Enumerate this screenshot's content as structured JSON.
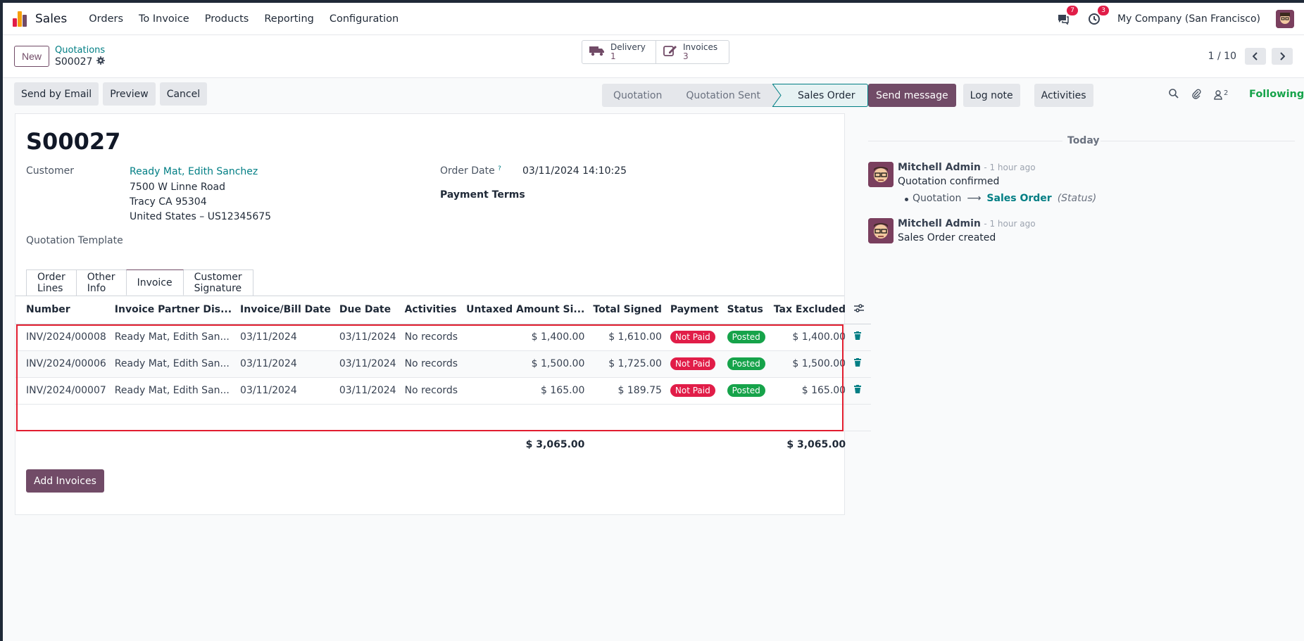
{
  "navbar": {
    "app_name": "Sales",
    "menu": [
      "Orders",
      "To Invoice",
      "Products",
      "Reporting",
      "Configuration"
    ],
    "messages_badge": "7",
    "activities_badge": "3",
    "company": "My Company (San Francisco)"
  },
  "control": {
    "new_label": "New",
    "breadcrumb_parent": "Quotations",
    "breadcrumb_current": "S00027",
    "smart_buttons": [
      {
        "label": "Delivery",
        "count": "1",
        "icon": "truck-icon"
      },
      {
        "label": "Invoices",
        "count": "3",
        "icon": "edit-icon"
      }
    ],
    "pager": "1 / 10"
  },
  "actions": {
    "send_email": "Send by Email",
    "preview": "Preview",
    "cancel": "Cancel"
  },
  "statusbar": [
    "Quotation",
    "Quotation Sent",
    "Sales Order"
  ],
  "form": {
    "title": "S00027",
    "customer_label": "Customer",
    "customer_name": "Ready Mat, Edith Sanchez",
    "address_lines": [
      "7500 W Linne Road",
      "Tracy CA 95304",
      "United States – US12345675"
    ],
    "quotation_template_label": "Quotation Template",
    "order_date_label": "Order Date",
    "order_date_help": "?",
    "order_date_value": "03/11/2024 14:10:25",
    "payment_terms_label": "Payment Terms"
  },
  "tabs": [
    "Order Lines",
    "Other Info",
    "Invoice",
    "Customer Signature"
  ],
  "invoices": {
    "columns": [
      "Number",
      "Invoice Partner Dis...",
      "Invoice/Bill Date",
      "Due Date",
      "Activities",
      "Untaxed Amount Si...",
      "Total Signed",
      "Payment",
      "Status",
      "Tax Excluded"
    ],
    "rows": [
      {
        "number": "INV/2024/00008",
        "partner": "Ready Mat, Edith San...",
        "date": "03/11/2024",
        "due": "03/11/2024",
        "activities": "No records",
        "untaxed": "$ 1,400.00",
        "total": "$ 1,610.00",
        "payment": "Not Paid",
        "status": "Posted",
        "tax_excluded": "$ 1,400.00"
      },
      {
        "number": "INV/2024/00006",
        "partner": "Ready Mat, Edith San...",
        "date": "03/11/2024",
        "due": "03/11/2024",
        "activities": "No records",
        "untaxed": "$ 1,500.00",
        "total": "$ 1,725.00",
        "payment": "Not Paid",
        "status": "Posted",
        "tax_excluded": "$ 1,500.00"
      },
      {
        "number": "INV/2024/00007",
        "partner": "Ready Mat, Edith San...",
        "date": "03/11/2024",
        "due": "03/11/2024",
        "activities": "No records",
        "untaxed": "$ 165.00",
        "total": "$ 189.75",
        "payment": "Not Paid",
        "status": "Posted",
        "tax_excluded": "$ 165.00"
      }
    ],
    "total_untaxed": "$ 3,065.00",
    "total_tax_excluded": "$ 3,065.00",
    "add_button": "Add Invoices"
  },
  "chatter": {
    "send_message": "Send message",
    "log_note": "Log note",
    "activities": "Activities",
    "followers_count": "2",
    "following": "Following",
    "date_separator": "Today",
    "messages": [
      {
        "author": "Mitchell Admin",
        "time": "- 1 hour ago",
        "body": "Quotation confirmed",
        "tracking": {
          "old": "Quotation",
          "new": "Sales Order",
          "field": "(Status)"
        }
      },
      {
        "author": "Mitchell Admin",
        "time": "- 1 hour ago",
        "body": "Sales Order created"
      }
    ]
  },
  "colors": {
    "brand": "#714b67",
    "link": "#017e84",
    "danger": "#e11d48",
    "success": "#16a34a"
  }
}
